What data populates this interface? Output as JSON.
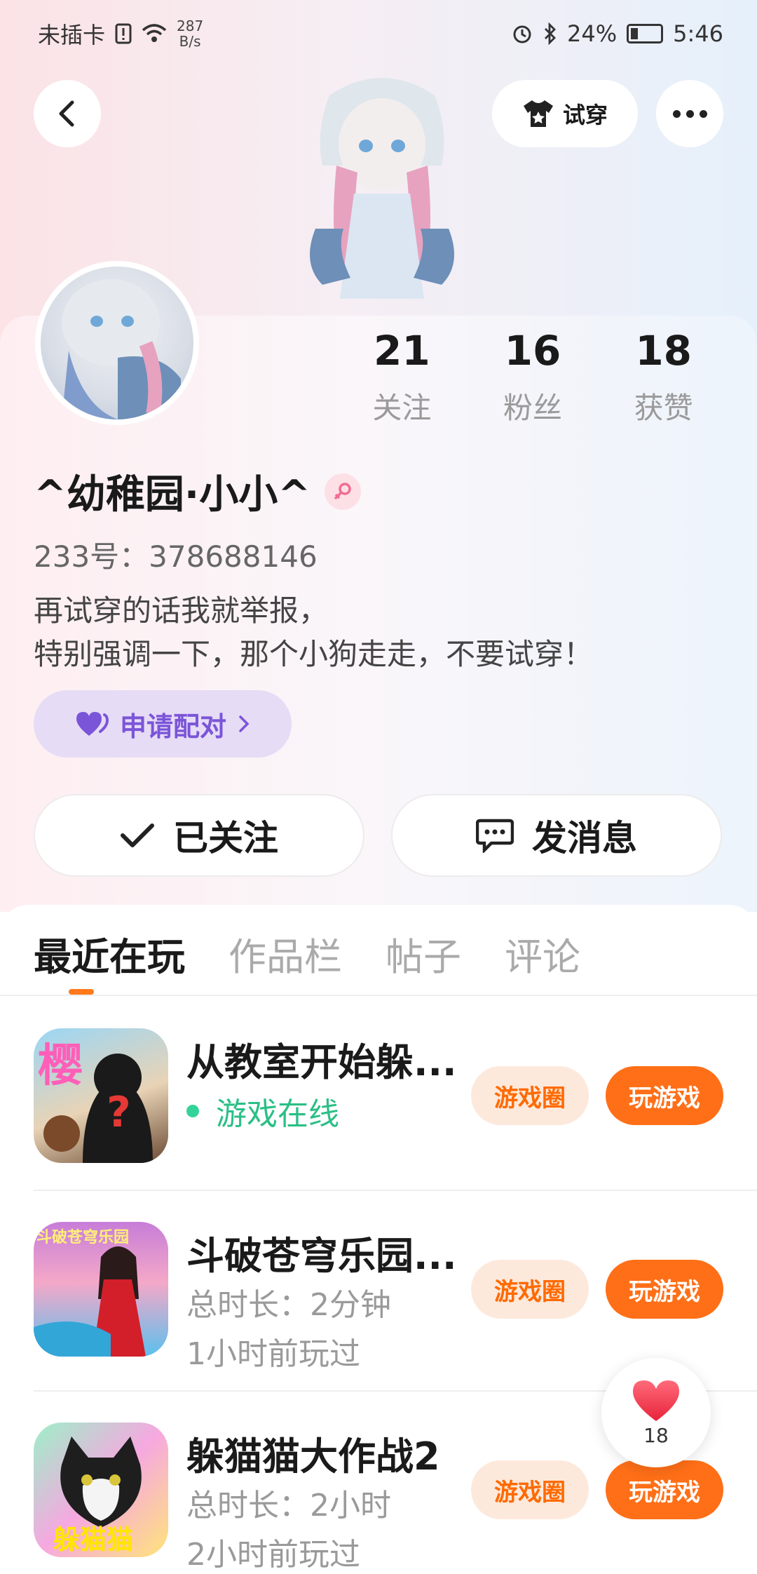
{
  "status_bar": {
    "carrier": "未插卡",
    "net_speed_value": "287",
    "net_speed_unit": "B/s",
    "battery": "24%",
    "time": "5:46"
  },
  "header": {
    "try_on_label": "试穿"
  },
  "profile": {
    "stats": [
      {
        "value": "21",
        "label": "关注"
      },
      {
        "value": "16",
        "label": "粉丝"
      },
      {
        "value": "18",
        "label": "获赞"
      }
    ],
    "username": "^幼稚园·小小^",
    "uid": "233号：378688146",
    "bio_line1": "再试穿的话我就举报，",
    "bio_line2": "特别强调一下，那个小狗走走，不要试穿！",
    "pair_label": "申请配对",
    "follow_label": "已关注",
    "message_label": "发消息"
  },
  "tabs": [
    "最近在玩",
    "作品栏",
    "帖子",
    "评论"
  ],
  "games": [
    {
      "title": "从教室开始躲...",
      "line1": "游戏在线",
      "line2": "",
      "icon_text": "樱",
      "circle_label": "游戏圈",
      "play_label": "玩游戏"
    },
    {
      "title": "斗破苍穹乐园...",
      "line1": "总时长：2分钟",
      "line2": "1小时前玩过",
      "icon_text": "斗破苍穹乐园",
      "circle_label": "游戏圈",
      "play_label": "玩游戏"
    },
    {
      "title": "躲猫猫大作战2",
      "line1": "总时长：2小时",
      "line2": "2小时前玩过",
      "icon_text": "躲猫猫",
      "circle_label": "游戏圈",
      "play_label": "玩游戏"
    }
  ],
  "like_fab": {
    "count": "18"
  },
  "colors": {
    "accent": "#ff6f17",
    "pair_purple": "#7b55d8",
    "online_green": "#2bbf86"
  }
}
